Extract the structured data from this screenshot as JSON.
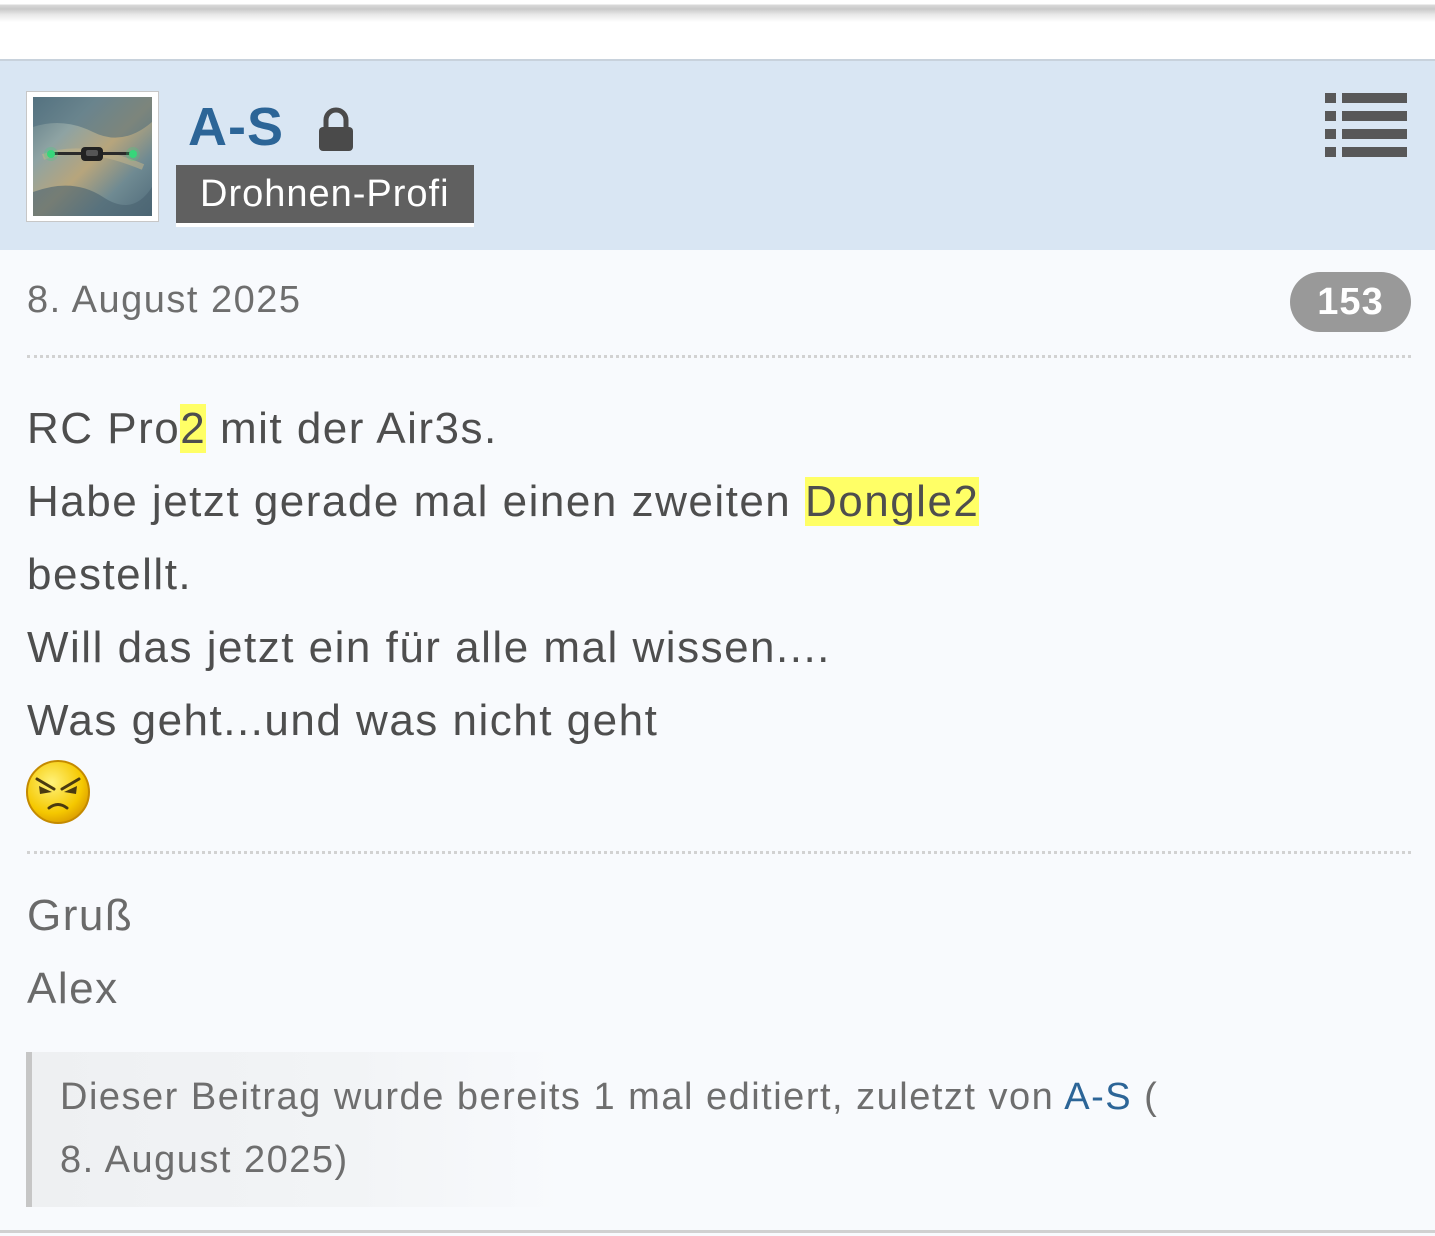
{
  "author": {
    "name": "A-S",
    "rank": "Drohnen-Profi",
    "avatar_icon": "drone-photo",
    "status_icon": "lock-icon"
  },
  "post": {
    "date": "8. August 2025",
    "number": "153",
    "menu_icon": "list-icon",
    "lines": [
      {
        "before": "RC Pro",
        "highlight": "2",
        "after": " mit der Air3s."
      },
      {
        "before": "Habe jetzt gerade mal einen zweiten ",
        "highlight": "Dongle2",
        "after": ""
      },
      {
        "text": "bestellt."
      },
      {
        "text": "Will das jetzt ein für alle mal wissen...."
      },
      {
        "text": "Was geht...und was nicht geht"
      }
    ],
    "emoji_icon": "angry-face-icon"
  },
  "signature": {
    "line1": "Gruß",
    "line2": "Alex"
  },
  "edit_note": {
    "prefix": "Dieser Beitrag wurde bereits 1 mal editiert, zuletzt von ",
    "editor": "A-S",
    "open_paren": " (",
    "date_line": "8. August 2025)"
  },
  "colors": {
    "header_bg": "#d9e6f3",
    "link": "#2c6597",
    "rank_badge": "#606060",
    "post_number_badge": "#999999",
    "highlight": "#ffff66"
  }
}
